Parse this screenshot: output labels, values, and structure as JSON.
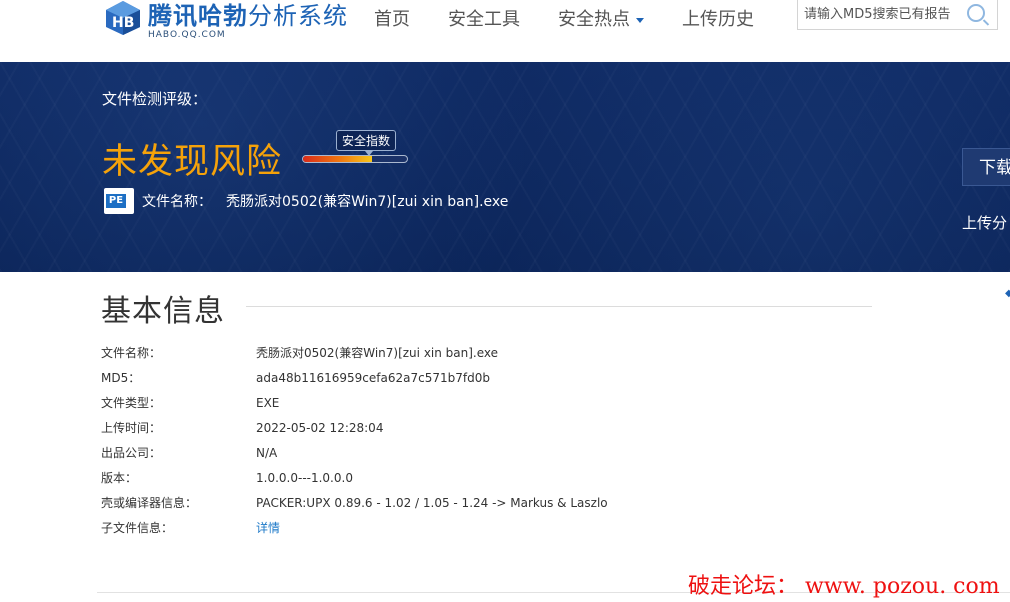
{
  "header": {
    "logo_title_bold": "腾讯哈勃",
    "logo_title_light": "分析系统",
    "logo_sub": "HABO.QQ.COM",
    "nav": [
      {
        "label": "首页"
      },
      {
        "label": "安全工具"
      },
      {
        "label": "安全热点",
        "has_dropdown": true
      },
      {
        "label": "上传历史"
      }
    ],
    "search_placeholder": "请输入MD5搜索已有报告",
    "search_icon": "search-icon"
  },
  "banner": {
    "rating_label": "文件检测评级：",
    "verdict": "未发现风险",
    "verdict_color": "#f5a20a",
    "score_label": "安全指数",
    "score_level": 0.66,
    "file_icon": "PE",
    "file_name_label": "文件名称：",
    "file_name": "秃肠派对0502(兼容Win7)[zui xin ban].exe",
    "download_label": "下载",
    "upload_text": "上传分"
  },
  "basic_info": {
    "title": "基本信息",
    "rows": [
      {
        "label": "文件名称：",
        "value": "秃肠派对0502(兼容Win7)[zui xin ban].exe"
      },
      {
        "label": "MD5：",
        "value": "ada48b11616959cefa62a7c571b7fd0b"
      },
      {
        "label": "文件类型：",
        "value": "EXE"
      },
      {
        "label": "上传时间：",
        "value": "2022-05-02 12:28:04"
      },
      {
        "label": "出品公司：",
        "value": "N/A"
      },
      {
        "label": "版本：",
        "value": "1.0.0.0---1.0.0.0"
      },
      {
        "label": "壳或编译器信息：",
        "value": "PACKER:UPX 0.89.6 - 1.02 / 1.05 - 1.24 -> Markus & Laszlo"
      },
      {
        "label": "子文件信息：",
        "value": "详情",
        "link": true
      }
    ]
  },
  "watermark": "破走论坛： www. pozou. com"
}
